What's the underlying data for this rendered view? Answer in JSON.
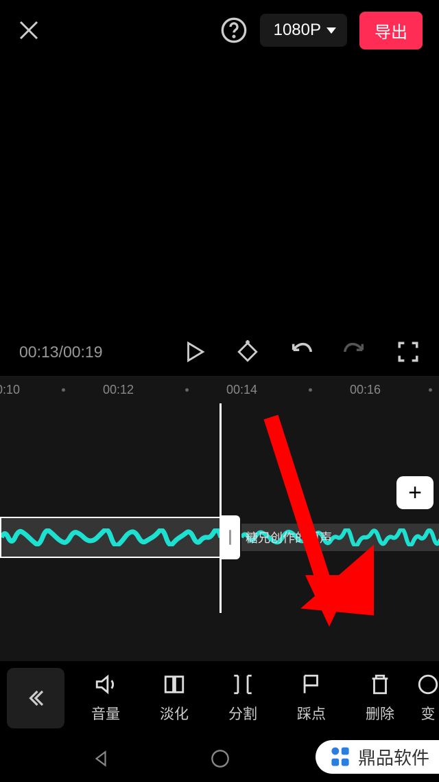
{
  "header": {
    "resolution": "1080P",
    "export_label": "导出"
  },
  "player": {
    "current_time": "00:13",
    "total_time": "00:19"
  },
  "timeline": {
    "ruler": [
      "0:10",
      "00:12",
      "00:14",
      "00:16"
    ],
    "audio_label": "糖兄创作的原声"
  },
  "toolbar": {
    "items": [
      {
        "label": "音量",
        "icon": "volume-icon"
      },
      {
        "label": "淡化",
        "icon": "fade-icon"
      },
      {
        "label": "分割",
        "icon": "split-icon"
      },
      {
        "label": "踩点",
        "icon": "beat-icon"
      },
      {
        "label": "删除",
        "icon": "delete-icon"
      },
      {
        "label": "变",
        "icon": "change-icon"
      }
    ]
  },
  "watermark": {
    "text": "鼎品软件"
  }
}
